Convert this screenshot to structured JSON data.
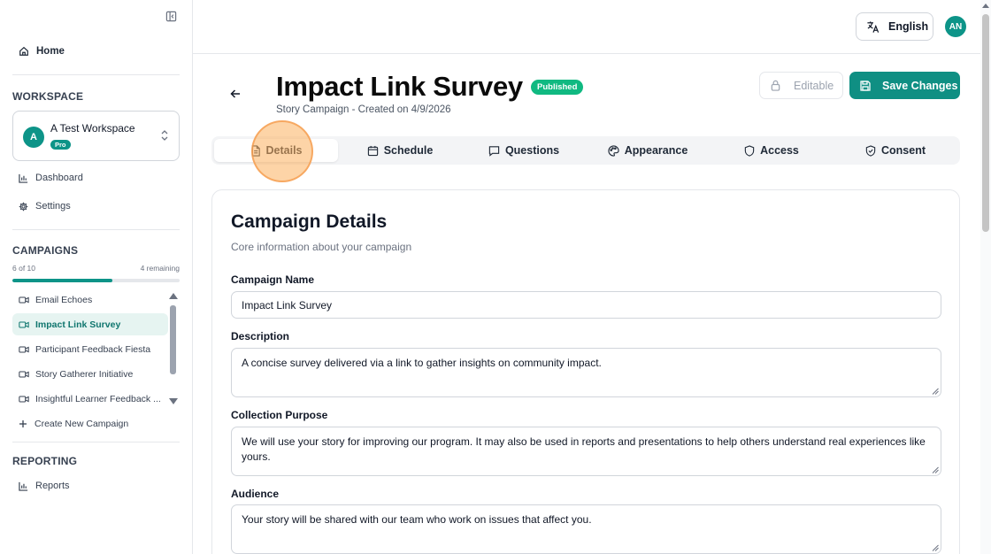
{
  "sidebar": {
    "home_label": "Home",
    "workspace_section": "WORKSPACE",
    "workspace": {
      "initial": "A",
      "name": "A Test Workspace",
      "plan": "Pro"
    },
    "workspace_nav": [
      {
        "label": "Dashboard",
        "icon": "bar-chart-icon"
      },
      {
        "label": "Settings",
        "icon": "gear-icon"
      }
    ],
    "campaigns_section": "CAMPAIGNS",
    "campaign_usage": {
      "used_text": "6 of 10",
      "remaining_text": "4 remaining",
      "fraction": 0.6
    },
    "campaigns": [
      {
        "label": "Email Echoes",
        "active": false
      },
      {
        "label": "Impact Link Survey",
        "active": true
      },
      {
        "label": "Participant Feedback Fiesta",
        "active": false
      },
      {
        "label": "Story Gatherer Initiative",
        "active": false
      },
      {
        "label": "Insightful Learner Feedback ...",
        "active": false
      }
    ],
    "create_campaign_label": "Create New Campaign",
    "reporting_section": "REPORTING",
    "reports_label": "Reports"
  },
  "topbar": {
    "language_label": "English",
    "user_initials": "AN"
  },
  "header": {
    "title": "Impact Link Survey",
    "status_badge": "Published",
    "subtitle": "Story Campaign - Created on 4/9/2026",
    "editable_label": "Editable",
    "save_label": "Save Changes"
  },
  "tabs": [
    {
      "label": "Details",
      "icon": "document-icon",
      "active": true
    },
    {
      "label": "Schedule",
      "icon": "calendar-icon",
      "active": false
    },
    {
      "label": "Questions",
      "icon": "message-icon",
      "active": false
    },
    {
      "label": "Appearance",
      "icon": "palette-icon",
      "active": false
    },
    {
      "label": "Access",
      "icon": "shield-icon",
      "active": false
    },
    {
      "label": "Consent",
      "icon": "shield-check-icon",
      "active": false
    }
  ],
  "details": {
    "title": "Campaign Details",
    "description": "Core information about your campaign",
    "fields": {
      "name": {
        "label": "Campaign Name",
        "value": "Impact Link Survey"
      },
      "description": {
        "label": "Description",
        "value": "A concise survey delivered via a link to gather insights on community impact."
      },
      "purpose": {
        "label": "Collection Purpose",
        "value": "We will use your story for improving our program. It may also be used in reports and presentations to help others understand real experiences like yours."
      },
      "audience": {
        "label": "Audience",
        "value": "Your story will be shared with our team who work on issues that affect you."
      }
    }
  },
  "colors": {
    "accent": "#0d9488",
    "published": "#10b981",
    "active_item_bg": "#e6f4f1"
  }
}
